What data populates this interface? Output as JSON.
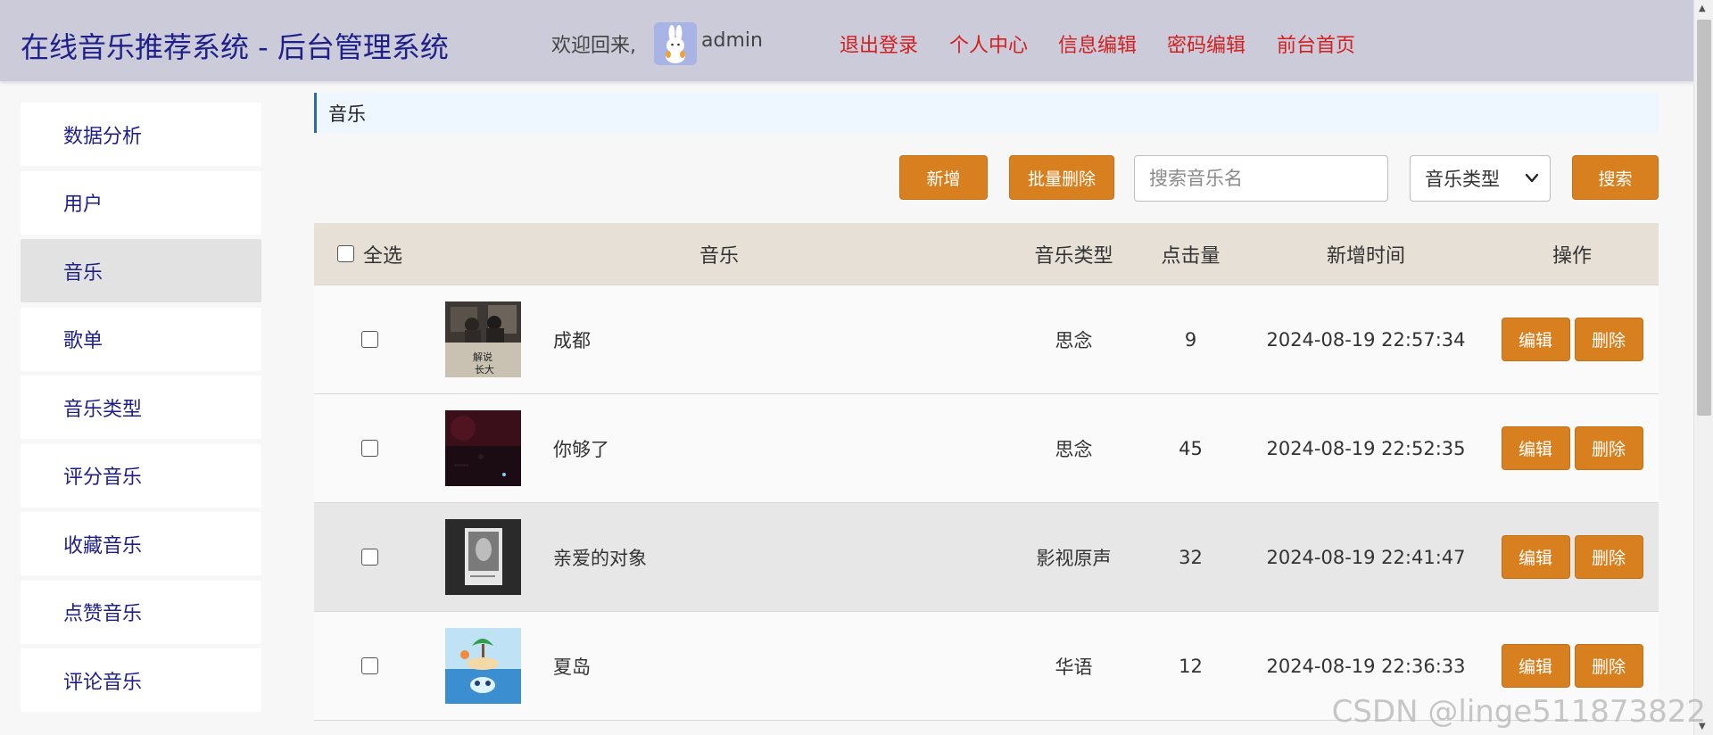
{
  "header": {
    "brand": "在线音乐推荐系统 - 后台管理系统",
    "welcome": "欢迎回来,",
    "username": "admin",
    "nav": [
      "退出登录",
      "个人中心",
      "信息编辑",
      "密码编辑",
      "前台首页"
    ]
  },
  "sidebar": {
    "items": [
      {
        "label": "数据分析"
      },
      {
        "label": "用户"
      },
      {
        "label": "音乐"
      },
      {
        "label": "歌单"
      },
      {
        "label": "音乐类型"
      },
      {
        "label": "评分音乐"
      },
      {
        "label": "收藏音乐"
      },
      {
        "label": "点赞音乐"
      },
      {
        "label": "评论音乐"
      }
    ],
    "active_index": 2
  },
  "breadcrumb": "音乐",
  "toolbar": {
    "add_label": "新增",
    "batch_delete_label": "批量删除",
    "search_placeholder": "搜索音乐名",
    "type_select_label": "音乐类型",
    "search_label": "搜索"
  },
  "table": {
    "headers": {
      "select_all": "全选",
      "music": "音乐",
      "type": "音乐类型",
      "clicks": "点击量",
      "time": "新增时间",
      "ops": "操作"
    },
    "edit_label": "编辑",
    "delete_label": "删除",
    "rows": [
      {
        "name": "成都",
        "type": "思念",
        "clicks": "9",
        "time": "2024-08-19 22:57:34"
      },
      {
        "name": "你够了",
        "type": "思念",
        "clicks": "45",
        "time": "2024-08-19 22:52:35"
      },
      {
        "name": "亲爱的对象",
        "type": "影视原声",
        "clicks": "32",
        "time": "2024-08-19 22:41:47"
      },
      {
        "name": "夏岛",
        "type": "华语",
        "clicks": "12",
        "time": "2024-08-19 22:36:33"
      }
    ]
  },
  "watermark": "CSDN @linge511873822",
  "colors": {
    "header_bg": "#cbcbd9",
    "brand": "#20208a",
    "nav_link": "#d31f1f",
    "accent_button": "#d8801f",
    "table_header_bg": "#e7e0d6",
    "breadcrumb_bg": "#eef6ff"
  }
}
